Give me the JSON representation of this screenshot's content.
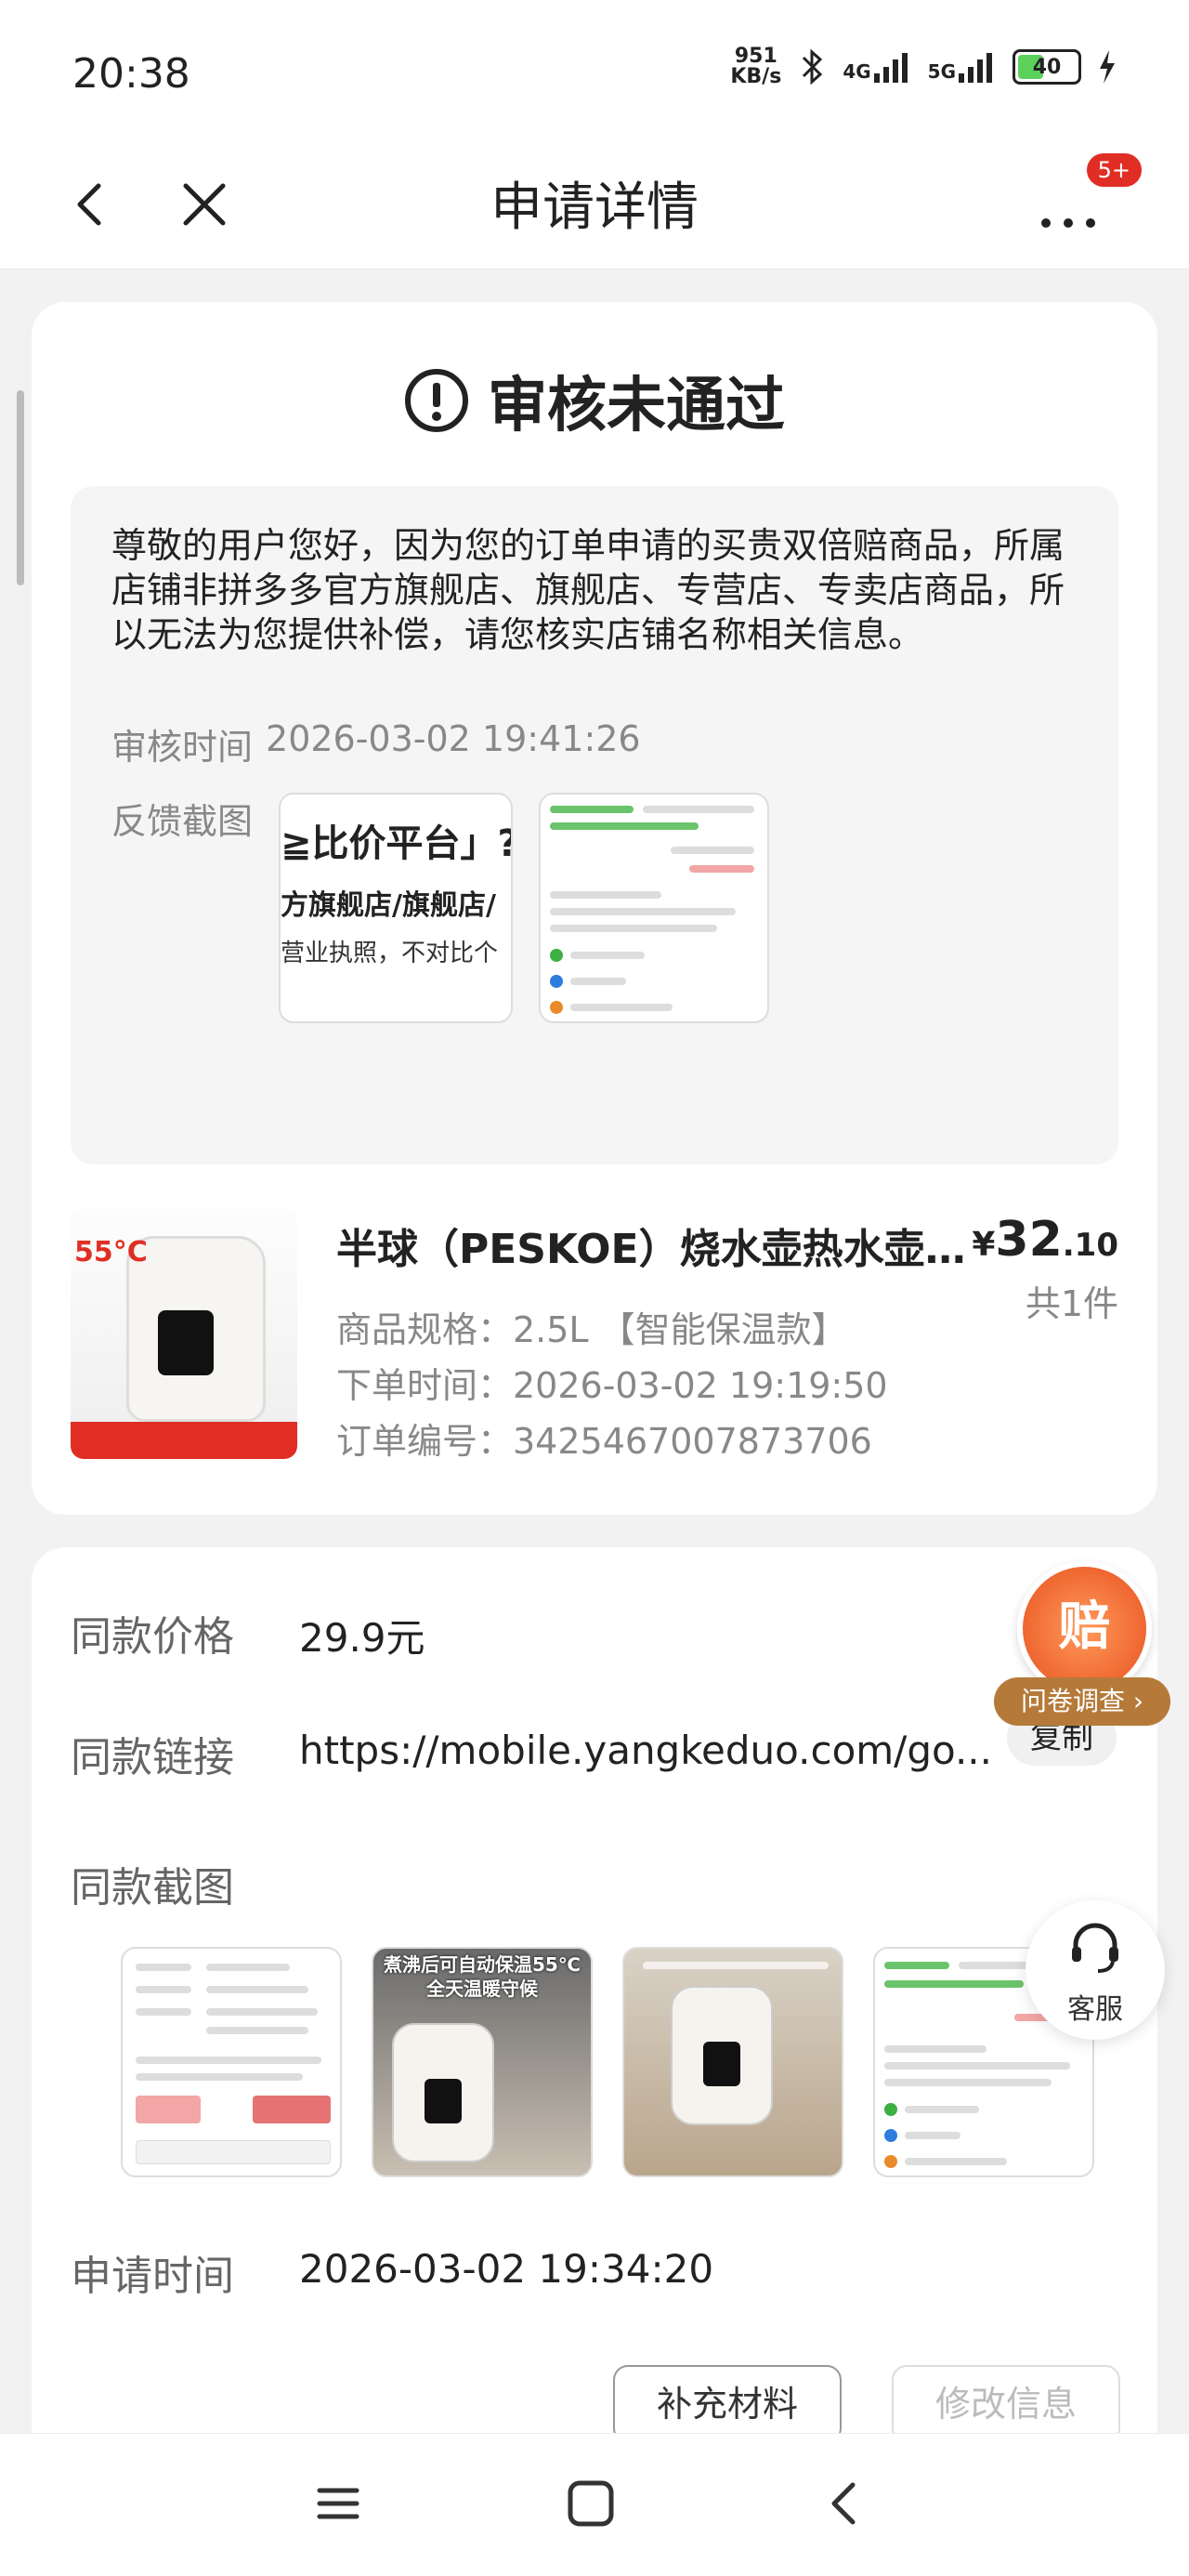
{
  "status_bar": {
    "time": "20:38",
    "net_speed_value": "951",
    "net_speed_unit": "KB/s",
    "signal1": "4G",
    "signal2": "5G",
    "battery": "40"
  },
  "header": {
    "title": "申请详情",
    "badge": "5+"
  },
  "result": {
    "status_title": "审核未通过",
    "reason": "尊敬的用户您好，因为您的订单申请的买贵双倍赔商品，所属店铺非拼多多官方旗舰店、旗舰店、专营店、专卖店商品，所以无法为您提供补偿，请您核实店铺名称相关信息。",
    "audit_time_label": "审核时间",
    "audit_time": "2026-03-02 19:41:26",
    "feedback_label": "反馈截图",
    "feedback_thumb1": {
      "line1": "≧比价平台」?",
      "line2": "方旗舰店/旗舰店/",
      "line3": "营业执照，不对比个"
    }
  },
  "product": {
    "name": "半球（PESKOE）烧水壶热水壶...",
    "price_currency": "¥",
    "price_int": "32",
    "price_dec": ".10",
    "quantity": "共1件",
    "spec": "商品规格：2.5L 【智能保温款】",
    "order_time": "下单时间：2026-03-02 19:19:50",
    "order_no": "订单编号：3425467007873706",
    "image_label": "55°C"
  },
  "details": {
    "same_price_label": "同款价格",
    "same_price": "29.9元",
    "same_link_label": "同款链接",
    "same_link": "https://mobile.yangkeduo.com/go...",
    "copy_label": "复制",
    "screenshots_label": "同款截图",
    "sc2_title": "煮沸后可自动保温55℃ 全天温暖守候",
    "apply_time_label": "申请时间",
    "apply_time": "2026-03-02 19:34:20"
  },
  "floating": {
    "pei": "赔",
    "survey": "问卷调查 ›",
    "service": "客服"
  },
  "actions": {
    "supplement": "补充材料",
    "modify": "修改信息"
  },
  "colors": {
    "accent": "#e02e24",
    "background": "#f2f2f2"
  }
}
